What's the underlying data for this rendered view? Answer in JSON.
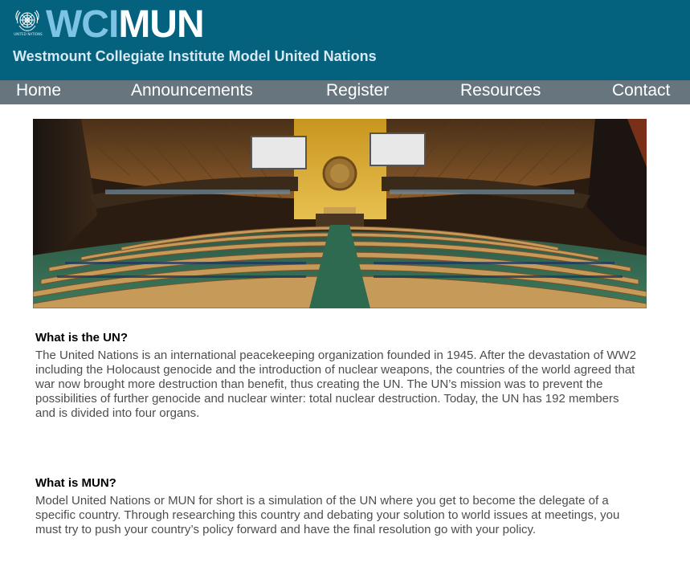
{
  "header": {
    "brand_part1": "WCI",
    "brand_part2": "MUN",
    "emblem_caption": "UNITED NATIONS",
    "subtitle": "Westmount Collegiate Institute Model United Nations",
    "colors": {
      "background": "#05627f",
      "brand_accent": "#7dc3e3",
      "brand_main": "#ffffff"
    },
    "logo_icon": "un-emblem-icon"
  },
  "nav": {
    "background": "#67757e",
    "items": [
      {
        "label": "Home"
      },
      {
        "label": "Announcements"
      },
      {
        "label": "Register"
      },
      {
        "label": "Resources"
      },
      {
        "label": "Contact"
      }
    ]
  },
  "hero": {
    "image": "general-assembly-hall-photo"
  },
  "sections": [
    {
      "heading": "What is the UN?",
      "body": "The United Nations is an international peacekeeping organization founded in 1945. After the devastation of WW2 including the Holocaust genocide and the introduction of nuclear weapons, the countries of the world agreed that war now brought more destruction than benefit, thus creating the UN. The UN’s mission was to prevent the possibilities of further genocide and nuclear winter: total nuclear destruction. Today, the UN has 192 members and is divided into four organs."
    },
    {
      "heading": "What is MUN?",
      "body": "Model United Nations or MUN for short is a simulation of the UN where you get to become the delegate of a specific country. Through researching this country and debating your solution to world issues at meetings, you must try to push your country’s policy forward and have the final resolution go with your policy."
    }
  ]
}
